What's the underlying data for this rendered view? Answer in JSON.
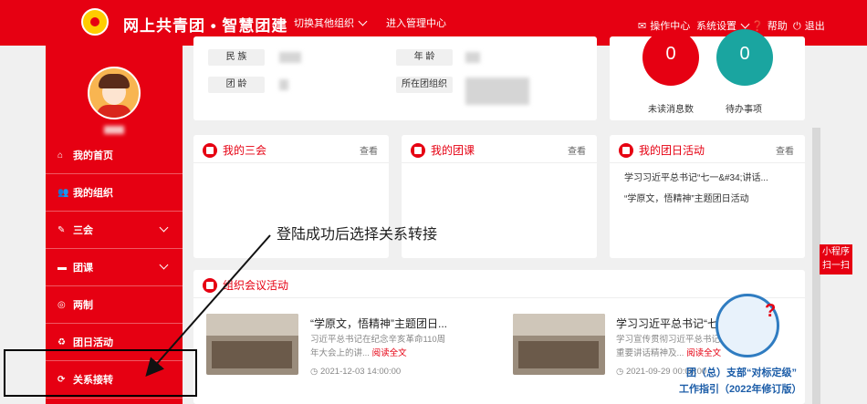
{
  "header": {
    "app_title": "网上共青团 • 智慧团建",
    "switch_org": "切换其他组织",
    "admin_center": "进入管理中心",
    "operation_center": "操作中心",
    "system_settings": "系统设置",
    "help": "帮助",
    "logout": "退出",
    "icons": {
      "operation": "mail-icon",
      "help": "question-icon",
      "logout": "power-icon"
    }
  },
  "sidebar": {
    "menu": [
      {
        "label": "我的首页",
        "icon": "home-icon",
        "glyph": "⌂",
        "has_chevron": false
      },
      {
        "label": "我的组织",
        "icon": "group-icon",
        "glyph": "👥",
        "has_chevron": false
      },
      {
        "label": "三会",
        "icon": "edit-icon",
        "glyph": "✎",
        "has_chevron": true
      },
      {
        "label": "团课",
        "icon": "folder-icon",
        "glyph": "▬",
        "has_chevron": true
      },
      {
        "label": "两制",
        "icon": "target-icon",
        "glyph": "◎",
        "has_chevron": false
      },
      {
        "label": "团日活动",
        "icon": "recycle-icon",
        "glyph": "♻",
        "has_chevron": false
      },
      {
        "label": "关系接转",
        "icon": "refresh-icon",
        "glyph": "⟳",
        "has_chevron": false
      }
    ]
  },
  "profile": {
    "labels": {
      "ethnicity": "民 族",
      "age": "年 龄",
      "league_age": "团 龄",
      "branch": "所在团组织"
    }
  },
  "stats": {
    "unread": {
      "value": "0",
      "label": "未读消息数",
      "color": "#e60012"
    },
    "todo": {
      "value": "0",
      "label": "待办事项",
      "color": "#1aa5a0"
    }
  },
  "cards": {
    "meetings": {
      "title": "我的三会",
      "more": "查看"
    },
    "courses": {
      "title": "我的团课",
      "more": "查看"
    },
    "league_day": {
      "title": "我的团日活动",
      "more": "查看",
      "items": [
        "学习习近平总书记“七一&#34;讲话...",
        "“学原文，悟精神”主题团日活动"
      ]
    }
  },
  "org_meetings": {
    "title": "组织会议活动",
    "news": [
      {
        "title": "“学原文，悟精神”主题团日...",
        "desc": "习近平总书记在纪念辛亥革命110周年大会上的讲...",
        "read_more": "阅读全文",
        "date": "2021-12-03 14:00:00"
      },
      {
        "title": "学习习近平总书记“七一...",
        "desc": "学习宣传贯彻习近平总书记重要讲话精神及...",
        "read_more": "阅读全文",
        "date": "2021-09-29 00:00:00"
      }
    ]
  },
  "annotation": {
    "text": "登陆成功后选择关系转接"
  },
  "qr_tab": {
    "line1": "小程序",
    "line2": "扫一扫"
  },
  "promo": {
    "line1": "团（总）支部“对标定级”",
    "line2": "工作指引（2022年修订版）"
  }
}
